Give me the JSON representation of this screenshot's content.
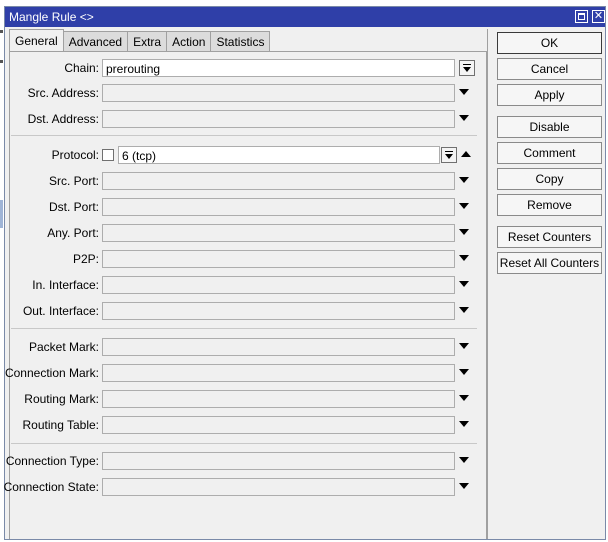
{
  "window": {
    "title": "Mangle Rule <>"
  },
  "tabs": [
    "General",
    "Advanced",
    "Extra",
    "Action",
    "Statistics"
  ],
  "fields": {
    "chain": {
      "label": "Chain:",
      "value": "prerouting"
    },
    "src_address": {
      "label": "Src. Address:"
    },
    "dst_address": {
      "label": "Dst. Address:"
    },
    "protocol": {
      "label": "Protocol:",
      "value": "6 (tcp)"
    },
    "src_port": {
      "label": "Src. Port:"
    },
    "dst_port": {
      "label": "Dst. Port:"
    },
    "any_port": {
      "label": "Any. Port:"
    },
    "p2p": {
      "label": "P2P:"
    },
    "in_interface": {
      "label": "In. Interface:"
    },
    "out_interface": {
      "label": "Out. Interface:"
    },
    "packet_mark": {
      "label": "Packet Mark:"
    },
    "connection_mark": {
      "label": "Connection Mark:"
    },
    "routing_mark": {
      "label": "Routing Mark:"
    },
    "routing_table": {
      "label": "Routing Table:"
    },
    "connection_type": {
      "label": "Connection Type:"
    },
    "connection_state": {
      "label": "Connection State:"
    }
  },
  "buttons": {
    "ok": "OK",
    "cancel": "Cancel",
    "apply": "Apply",
    "disable": "Disable",
    "comment": "Comment",
    "copy": "Copy",
    "remove": "Remove",
    "reset_counters": "Reset Counters",
    "reset_all_counters": "Reset All Counters"
  }
}
